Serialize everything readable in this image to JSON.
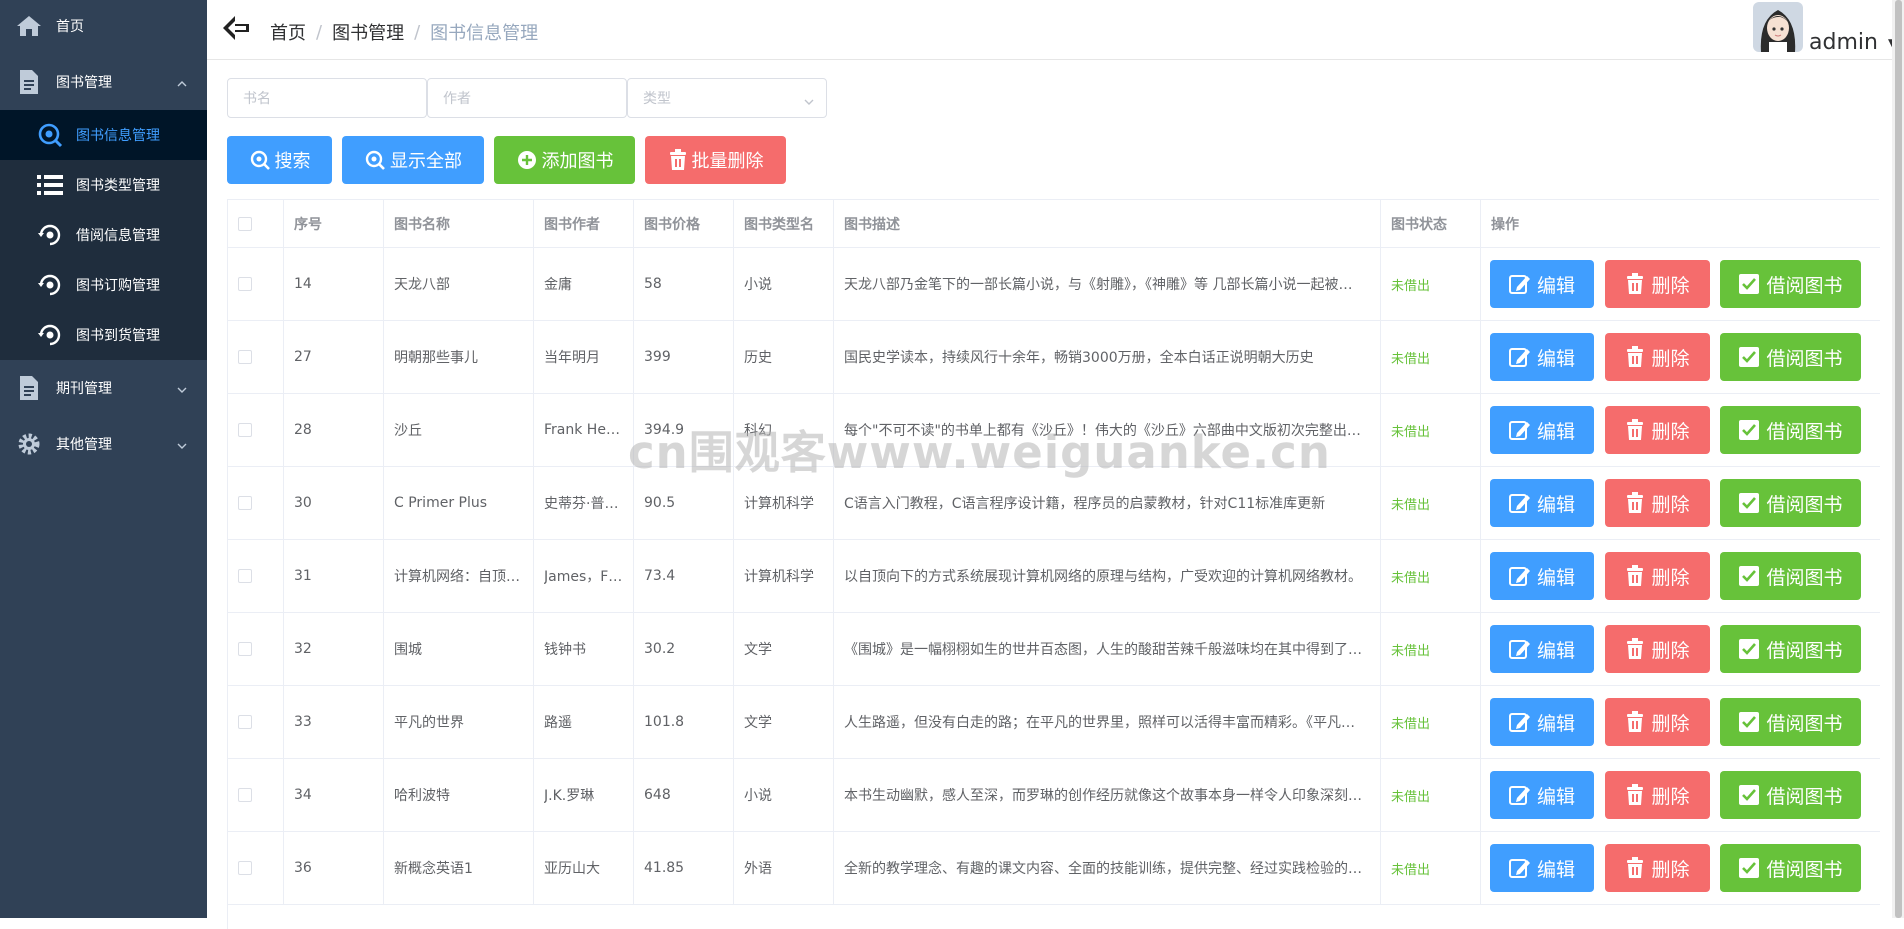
{
  "sidebar": {
    "home": "首页",
    "book_mgmt": "图书管理",
    "sub_items": [
      "图书信息管理",
      "图书类型管理",
      "借阅信息管理",
      "图书订购管理",
      "图书到货管理"
    ],
    "periodical_mgmt": "期刊管理",
    "other_mgmt": "其他管理"
  },
  "header": {
    "breadcrumb": [
      "首页",
      "图书管理",
      "图书信息管理"
    ],
    "user": "admin"
  },
  "filters": {
    "name_placeholder": "书名",
    "author_placeholder": "作者",
    "type_placeholder": "类型"
  },
  "toolbar": {
    "search": "搜索",
    "show_all": "显示全部",
    "add": "添加图书",
    "batch_delete": "批量删除"
  },
  "table": {
    "headers": [
      "序号",
      "图书名称",
      "图书作者",
      "图书价格",
      "图书类型名",
      "图书描述",
      "图书状态",
      "操作"
    ],
    "actions": {
      "edit": "编辑",
      "delete": "删除",
      "borrow": "借阅图书"
    },
    "rows": [
      {
        "id": "14",
        "name": "天龙八部",
        "author": "金庸",
        "price": "58",
        "type": "小说",
        "desc": "天龙八部乃金笔下的一部长篇小说，与《射雕》，《神雕》等 几部长篇小说一起被…",
        "status": "未借出"
      },
      {
        "id": "27",
        "name": "明朝那些事儿",
        "author": "当年明月",
        "price": "399",
        "type": "历史",
        "desc": "国民史学读本，持续风行十余年，畅销3000万册，全本白话正说明朝大历史",
        "status": "未借出"
      },
      {
        "id": "28",
        "name": "沙丘",
        "author": "Frank Her…",
        "price": "394.9",
        "type": "科幻",
        "desc": "每个\"不可不读\"的书单上都有《沙丘》！伟大的《沙丘》六部曲中文版初次完整出…",
        "status": "未借出"
      },
      {
        "id": "30",
        "name": "C Primer Plus",
        "author": "史蒂芬·普…",
        "price": "90.5",
        "type": "计算机科学",
        "desc": "C语言入门教程，C语言程序设计籍，程序员的启蒙教材，针对C11标准库更新",
        "status": "未借出"
      },
      {
        "id": "31",
        "name": "计算机网络：自顶…",
        "author": "James，F…",
        "price": "73.4",
        "type": "计算机科学",
        "desc": "以自顶向下的方式系统展现计算机网络的原理与结构，广受欢迎的计算机网络教材。",
        "status": "未借出"
      },
      {
        "id": "32",
        "name": "围城",
        "author": "钱钟书",
        "price": "30.2",
        "type": "文学",
        "desc": "《围城》是一幅栩栩如生的世井百态图，人生的酸甜苦辣千般滋味均在其中得到了…",
        "status": "未借出"
      },
      {
        "id": "33",
        "name": "平凡的世界",
        "author": "路遥",
        "price": "101.8",
        "type": "文学",
        "desc": "人生路遥，但没有白走的路；在平凡的世界里，照样可以活得丰富而精彩。《平凡…",
        "status": "未借出"
      },
      {
        "id": "34",
        "name": "哈利波特",
        "author": "J.K.罗琳",
        "price": "648",
        "type": "小说",
        "desc": "本书生动幽默，感人至深，而罗琳的创作经历就像这个故事本身一样令人印象深刻…",
        "status": "未借出"
      },
      {
        "id": "36",
        "name": "新概念英语1",
        "author": "亚历山大",
        "price": "41.85",
        "type": "外语",
        "desc": "全新的教学理念、有趣的课文内容、全面的技能训练，提供完整、经过实践检验的…",
        "status": "未借出"
      }
    ]
  },
  "watermark": "cn围观客www.weiguanke.cn",
  "colors": {
    "primary": "#409eff",
    "success": "#67c23a",
    "danger": "#f56c6c",
    "sidebar": "#304156"
  }
}
